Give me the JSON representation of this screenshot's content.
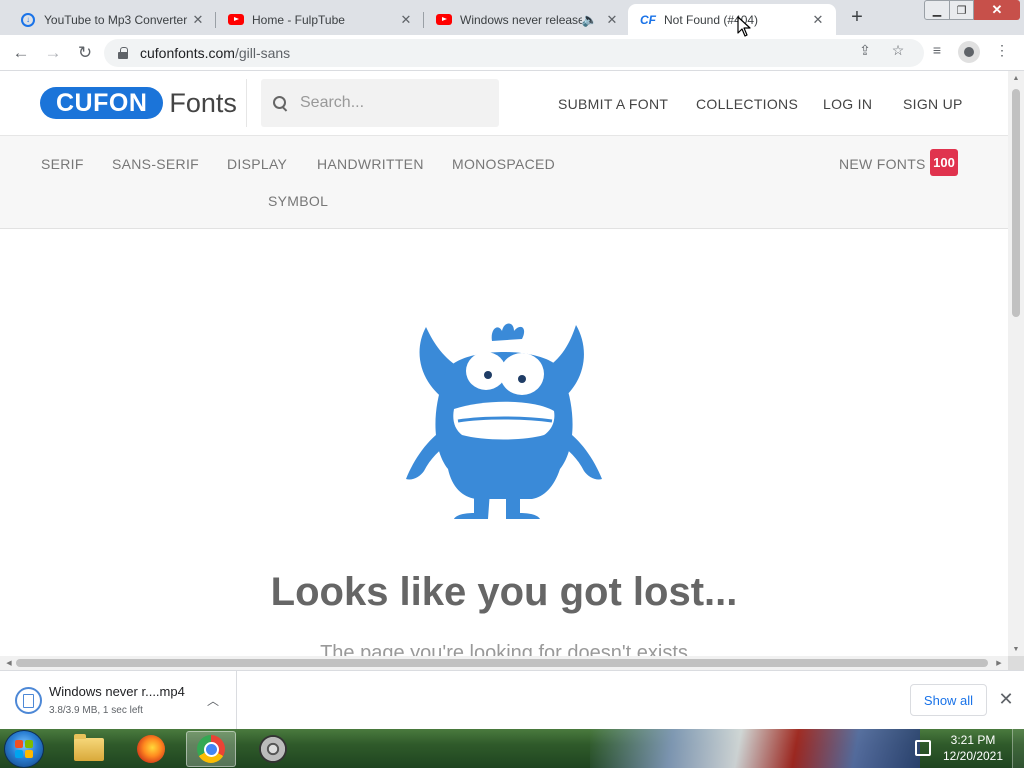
{
  "browser": {
    "tabs": [
      {
        "title": "YouTube to Mp3 Converter",
        "favicon": "download-favicon-icon",
        "active": false
      },
      {
        "title": "Home - FulpTube",
        "favicon": "youtube-favicon-icon",
        "active": false
      },
      {
        "title": "Windows never release",
        "favicon": "youtube-favicon-icon",
        "active": false,
        "audio": true
      },
      {
        "title": "Not Found (#404)",
        "favicon": "cf-favicon-icon",
        "favicon_text": "CF",
        "active": true
      }
    ],
    "address": {
      "domain": "cufonfonts.com",
      "path": "/gill-sans"
    }
  },
  "site": {
    "logo": {
      "badge": "CUFON",
      "word": "Fonts"
    },
    "search": {
      "placeholder": "Search..."
    },
    "nav": [
      "SUBMIT A FONT",
      "COLLECTIONS",
      "LOG IN",
      "SIGN UP"
    ],
    "categories": [
      "SERIF",
      "SANS-SERIF",
      "DISPLAY",
      "HANDWRITTEN",
      "MONOSPACED",
      "SYMBOL"
    ],
    "new_fonts": {
      "label": "NEW FONTS",
      "count": "100"
    },
    "error": {
      "title": "Looks like you got lost...",
      "subtitle": "The page you're looking for doesn't exists"
    },
    "colors": {
      "brand_blue": "#1b74d9",
      "monster_blue": "#3a8ad8",
      "badge_red": "#e0334e"
    }
  },
  "downloads": {
    "item": {
      "name": "Windows never r....mp4",
      "status": "3.8/3.9 MB, 1 sec left"
    },
    "show_all": "Show all"
  },
  "taskbar": {
    "apps": [
      "file-explorer-icon",
      "firefox-icon",
      "chrome-icon",
      "media-player-icon"
    ],
    "clock": {
      "time": "3:21 PM",
      "date": "12/20/2021"
    }
  }
}
